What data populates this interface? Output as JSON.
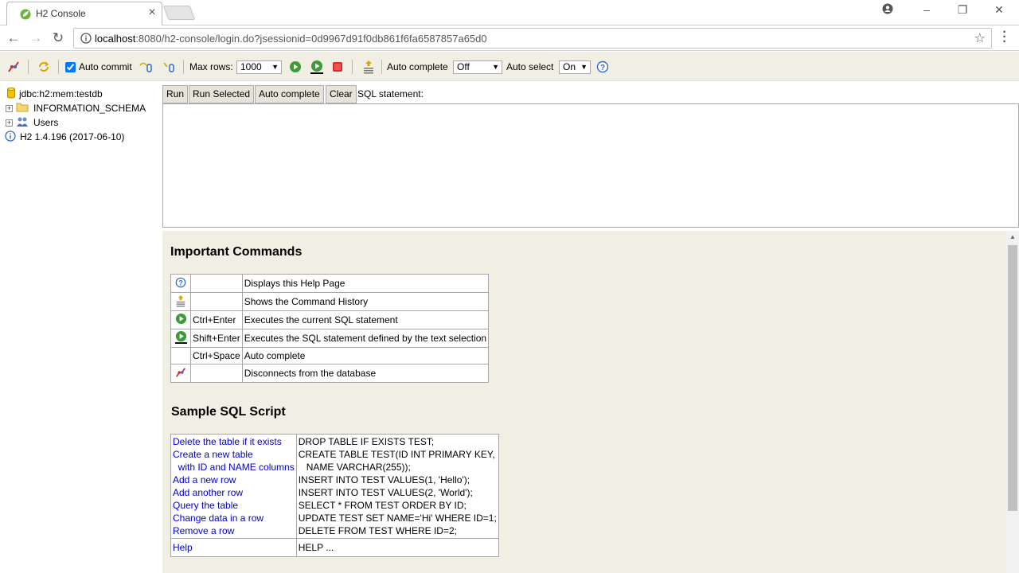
{
  "browser": {
    "tab_title": "H2 Console",
    "url_host": "localhost",
    "url_rest": ":8080/h2-console/login.do?jsessionid=0d9967d91f0db861f6fa6587857a65d0"
  },
  "toolbar": {
    "auto_commit_label": "Auto commit",
    "auto_commit_checked": true,
    "max_rows_label": "Max rows:",
    "max_rows_value": "1000",
    "auto_complete_label": "Auto complete",
    "auto_complete_value": "Off",
    "auto_select_label": "Auto select",
    "auto_select_value": "On"
  },
  "tree": {
    "connection": "jdbc:h2:mem:testdb",
    "schema": "INFORMATION_SCHEMA",
    "users": "Users",
    "version": "H2 1.4.196 (2017-06-10)"
  },
  "query": {
    "run_label": "Run",
    "run_selected_label": "Run Selected",
    "auto_complete_label": "Auto complete",
    "clear_label": "Clear",
    "sql_label": "SQL statement:",
    "sql_value": ""
  },
  "help": {
    "commands_title": "Important Commands",
    "commands": [
      {
        "icon": "help-icon",
        "key": "",
        "desc": "Displays this Help Page"
      },
      {
        "icon": "history-icon",
        "key": "",
        "desc": "Shows the Command History"
      },
      {
        "icon": "run-icon",
        "key": "Ctrl+Enter",
        "desc": "Executes the current SQL statement"
      },
      {
        "icon": "run-selected-icon",
        "key": "Shift+Enter",
        "desc": "Executes the SQL statement defined by the text selection"
      },
      {
        "icon": "",
        "key": "Ctrl+Space",
        "desc": "Auto complete"
      },
      {
        "icon": "disconnect-icon",
        "key": "",
        "desc": "Disconnects from the database"
      }
    ],
    "sample_title": "Sample SQL Script",
    "sample": [
      {
        "label": "Delete the table if it exists",
        "code": "DROP TABLE IF EXISTS TEST;"
      },
      {
        "label": "Create a new table",
        "code": "CREATE TABLE TEST(ID INT PRIMARY KEY,"
      },
      {
        "label": "  with ID and NAME columns",
        "code": "   NAME VARCHAR(255));"
      },
      {
        "label": "Add a new row",
        "code": "INSERT INTO TEST VALUES(1, 'Hello');"
      },
      {
        "label": "Add another row",
        "code": "INSERT INTO TEST VALUES(2, 'World');"
      },
      {
        "label": "Query the table",
        "code": "SELECT * FROM TEST ORDER BY ID;"
      },
      {
        "label": "Change data in a row",
        "code": "UPDATE TEST SET NAME='Hi' WHERE ID=1;"
      },
      {
        "label": "Remove a row",
        "code": "DELETE FROM TEST WHERE ID=2;"
      }
    ],
    "help_link": "Help",
    "help_code": "HELP ..."
  },
  "colors": {
    "panel_bg": "#f1efe3",
    "link": "#0000cc",
    "run_green": "#3c9a37",
    "stop_red": "#d22d2d"
  }
}
